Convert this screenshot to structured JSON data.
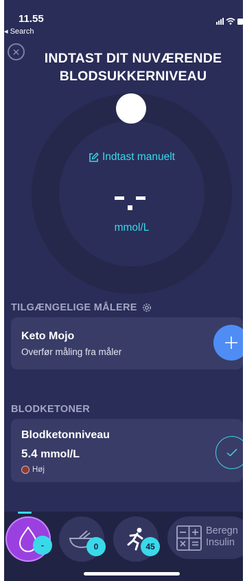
{
  "status_bar": {
    "time": "11.55",
    "back_label": "◂ Search"
  },
  "header": {
    "close_symbol": "✕",
    "title": "INDTAST DIT NUVÆRENDE BLODSUKKERNIVEAU"
  },
  "dial": {
    "manual_entry_label": "Indtast manuelt",
    "reading_placeholder": "-.-",
    "unit": "mmol/L"
  },
  "meters": {
    "section_label": "TILGÆNGELIGE MÅLERE",
    "card": {
      "title": "Keto Mojo",
      "subtitle": "Overfør måling fra måler"
    }
  },
  "ketones": {
    "section_label": "BLODKETONER",
    "card": {
      "title": "Blodketonniveau",
      "value": "5.4",
      "unit": "mmol/L",
      "status": "Høj"
    }
  },
  "bottom_nav": {
    "tabs": [
      {
        "name": "glucose",
        "badge": "-"
      },
      {
        "name": "food",
        "badge": "0"
      },
      {
        "name": "activity",
        "badge": "45"
      }
    ],
    "calculator": {
      "line1": "Beregn",
      "line2": "Insulin"
    }
  },
  "colors": {
    "background": "#2a2d58",
    "accent": "#39d9e9",
    "add_button": "#4f8df5",
    "active_tab": "#9b40e0",
    "status_high": "#8a3c38"
  }
}
